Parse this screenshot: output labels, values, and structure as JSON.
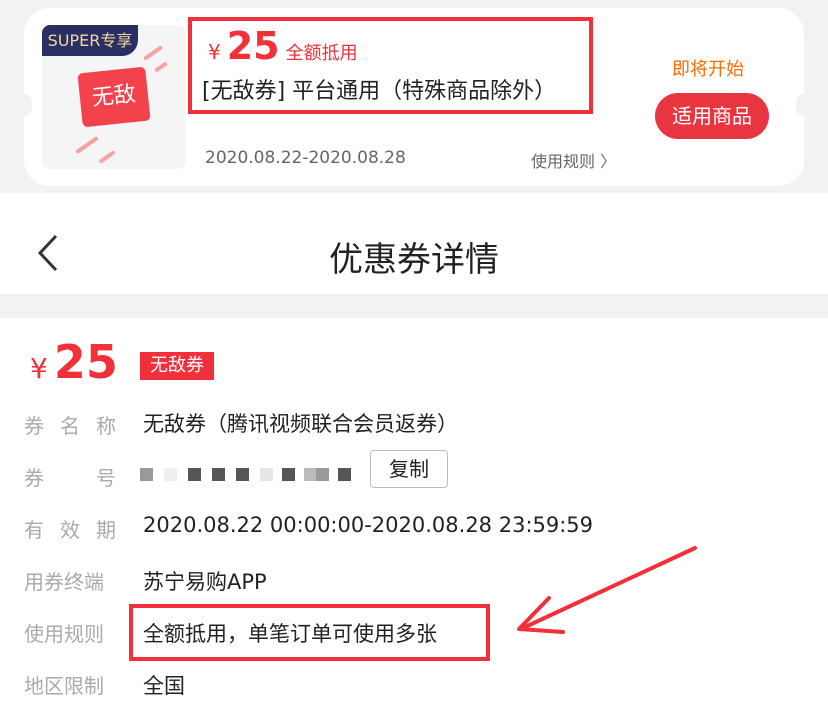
{
  "coupon_card": {
    "super_badge": "SUPER专享",
    "logo_text": "无敌",
    "currency": "¥",
    "amount": "25",
    "amount_tag": "全额抵用",
    "title": "[无敌券] 平台通用（特殊商品除外）",
    "date_range": "2020.08.22-2020.08.28",
    "rules_link": "使用规则 〉",
    "status": "即将开始",
    "button_label": "适用商品",
    "colors": {
      "accent": "#f2303a",
      "status": "#ff6a00",
      "badge_bg": "#2a2f63"
    }
  },
  "nav": {
    "back_icon": "chevron-left-icon",
    "title": "优惠券详情"
  },
  "detail": {
    "currency": "¥",
    "amount": "25",
    "badge": "无敌券",
    "rows": [
      {
        "label": "券名称",
        "value": "无敌券（腾讯视频联合会员返券）"
      },
      {
        "label": "券号",
        "value": ""
      },
      {
        "label": "有效期",
        "value": "2020.08.22 00:00:00-2020.08.28 23:59:59"
      },
      {
        "label": "用券终端",
        "value": "苏宁易购APP"
      },
      {
        "label": "使用规则",
        "value": "全额抵用，单笔订单可使用多张"
      },
      {
        "label": "地区限制",
        "value": "全国"
      }
    ],
    "copy_button": "复制"
  }
}
